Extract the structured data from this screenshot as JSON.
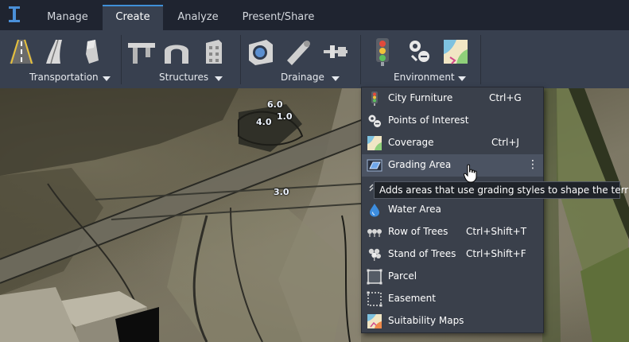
{
  "tabs": [
    {
      "label": "Manage",
      "active": false
    },
    {
      "label": "Create",
      "active": true
    },
    {
      "label": "Analyze",
      "active": false
    },
    {
      "label": "Present/Share",
      "active": false
    }
  ],
  "ribbon": {
    "groups": [
      {
        "label": "Transportation",
        "icons": [
          "road-icon",
          "highway-icon",
          "railway-icon"
        ]
      },
      {
        "label": "Structures",
        "icons": [
          "bridge-icon",
          "tunnel-icon",
          "building-icon"
        ]
      },
      {
        "label": "Drainage",
        "icons": [
          "pond-icon",
          "pipe-icon",
          "culvert-icon"
        ]
      },
      {
        "label": "Environment",
        "icons": [
          "traffic-light-icon",
          "points-of-interest-icon",
          "coverage-icon"
        ]
      }
    ]
  },
  "menu": {
    "items": [
      {
        "label": "City Furniture",
        "shortcut": "Ctrl+G",
        "icon": "city-furniture-icon"
      },
      {
        "label": "Points of Interest",
        "shortcut": "",
        "icon": "points-of-interest-icon"
      },
      {
        "label": "Coverage",
        "shortcut": "Ctrl+J",
        "icon": "coverage-icon"
      },
      {
        "label": "Grading Area",
        "shortcut": "",
        "icon": "grading-area-icon",
        "hovered": true
      },
      {
        "label": "",
        "shortcut": "",
        "icon": "barrier-icon"
      },
      {
        "label": "Water Area",
        "shortcut": "",
        "icon": "water-drop-icon"
      },
      {
        "label": "Row of Trees",
        "shortcut": "Ctrl+Shift+T",
        "icon": "row-of-trees-icon"
      },
      {
        "label": "Stand of Trees",
        "shortcut": "Ctrl+Shift+F",
        "icon": "stand-of-trees-icon"
      },
      {
        "label": "Parcel",
        "shortcut": "",
        "icon": "parcel-icon"
      },
      {
        "label": "Easement",
        "shortcut": "",
        "icon": "easement-icon"
      },
      {
        "label": "Suitability Maps",
        "shortcut": "",
        "icon": "suitability-maps-icon"
      }
    ],
    "more_glyph": "⋮"
  },
  "tooltip": {
    "text": "Adds areas that use grading styles to shape the terrain"
  },
  "map": {
    "labels": [
      "6.0",
      "1.0",
      "4.0",
      "3.0"
    ]
  },
  "colors": {
    "accent": "#3f8fd8",
    "ribbon_bg": "#38404f",
    "tabbar_bg": "#1f2430",
    "menu_bg": "#3a404b",
    "menu_hover": "#4b5362"
  }
}
